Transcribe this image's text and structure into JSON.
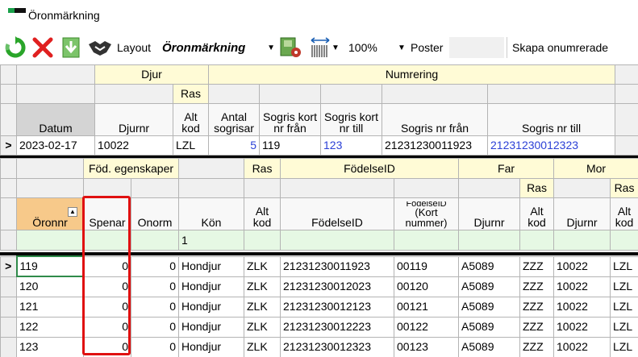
{
  "window": {
    "title": "Öronmärkning"
  },
  "toolbar": {
    "layout_label": "Layout",
    "layout_name": "Öronmärkning",
    "zoom": "100%",
    "poster_label": "Poster",
    "create_button": "Skapa onumrerade"
  },
  "top_grid": {
    "groups": {
      "djur": "Djur",
      "numrering": "Numrering",
      "ras": "Ras"
    },
    "headers": {
      "datum": "Datum",
      "djurnr": "Djurnr",
      "altkod": "Alt kod",
      "antal": "Antal sogrisar",
      "kort_fran": "Sogris kort nr från",
      "kort_till": "Sogris kort nr till",
      "nr_fran": "Sogris nr från",
      "nr_till": "Sogris nr till"
    },
    "row": {
      "marker": ">",
      "datum": "2023-02-17",
      "djurnr": "10022",
      "altkod": "LZL",
      "antal": "5",
      "kort_fran": "119",
      "kort_till": "123",
      "nr_fran": "21231230011923",
      "nr_till": "21231230012323"
    }
  },
  "bottom_grid": {
    "groups": {
      "fod": "Föd. egenskaper",
      "ras": "Ras",
      "fodelseid": "FödelseID",
      "far": "Far",
      "mor": "Mor",
      "far_ras": "Ras",
      "mor_ras": "Ras"
    },
    "headers": {
      "oronnr": "Öronnr",
      "spenar": "Spenar",
      "onorm": "Onorm",
      "kon": "Kön",
      "altkod": "Alt kod",
      "fodelseid": "FödelseID",
      "fodelseid_top": "FödelseID",
      "kortnr": "(Kort nummer)",
      "far_djurnr": "Djurnr",
      "far_altkod": "Alt kod",
      "mor_djurnr": "Djurnr",
      "mor_altkod": "Alt kod"
    },
    "filter": {
      "kon": "1"
    },
    "rows": [
      {
        "marker": ">",
        "oronnr": "119",
        "spenar": "0",
        "onorm": "0",
        "kon": "Hondjur",
        "altkod": "ZLK",
        "fodelseid": "21231230011923",
        "kortnr": "00119",
        "far_djurnr": "A5089",
        "far_altkod": "ZZZ",
        "mor_djurnr": "10022",
        "mor_altkod": "LZL"
      },
      {
        "marker": "",
        "oronnr": "120",
        "spenar": "0",
        "onorm": "0",
        "kon": "Hondjur",
        "altkod": "ZLK",
        "fodelseid": "21231230012023",
        "kortnr": "00120",
        "far_djurnr": "A5089",
        "far_altkod": "ZZZ",
        "mor_djurnr": "10022",
        "mor_altkod": "LZL"
      },
      {
        "marker": "",
        "oronnr": "121",
        "spenar": "0",
        "onorm": "0",
        "kon": "Hondjur",
        "altkod": "ZLK",
        "fodelseid": "21231230012123",
        "kortnr": "00121",
        "far_djurnr": "A5089",
        "far_altkod": "ZZZ",
        "mor_djurnr": "10022",
        "mor_altkod": "LZL"
      },
      {
        "marker": "",
        "oronnr": "122",
        "spenar": "0",
        "onorm": "0",
        "kon": "Hondjur",
        "altkod": "ZLK",
        "fodelseid": "21231230012223",
        "kortnr": "00122",
        "far_djurnr": "A5089",
        "far_altkod": "ZZZ",
        "mor_djurnr": "10022",
        "mor_altkod": "LZL"
      },
      {
        "marker": "",
        "oronnr": "123",
        "spenar": "0",
        "onorm": "0",
        "kon": "Hondjur",
        "altkod": "ZLK",
        "fodelseid": "21231230012323",
        "kortnr": "00123",
        "far_djurnr": "A5089",
        "far_altkod": "ZZZ",
        "mor_djurnr": "10022",
        "mor_altkod": "LZL"
      }
    ]
  },
  "colors": {
    "highlight": "#e01010",
    "link": "#2a3fd6",
    "group_header": "#fffbd6",
    "filter_row": "#e6f8e4",
    "sort_header": "#f7c98a"
  }
}
